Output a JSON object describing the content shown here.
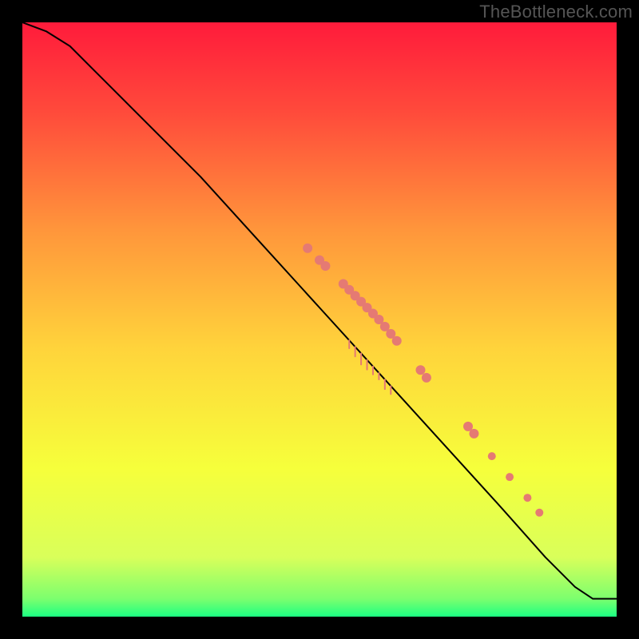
{
  "watermark": "TheBottleneck.com",
  "chart_data": {
    "type": "line",
    "title": "",
    "xlabel": "",
    "ylabel": "",
    "xlim": [
      0,
      100
    ],
    "ylim": [
      0,
      100
    ],
    "grid": false,
    "legend": false,
    "gradient_bg": {
      "stops": [
        {
          "offset": 0.0,
          "color": "#ff1b3b"
        },
        {
          "offset": 0.15,
          "color": "#ff4a3b"
        },
        {
          "offset": 0.35,
          "color": "#ff963b"
        },
        {
          "offset": 0.55,
          "color": "#ffd43b"
        },
        {
          "offset": 0.75,
          "color": "#f6ff3b"
        },
        {
          "offset": 0.9,
          "color": "#d9ff5a"
        },
        {
          "offset": 0.97,
          "color": "#7cff6e"
        },
        {
          "offset": 1.0,
          "color": "#1cff82"
        }
      ]
    },
    "series": [
      {
        "name": "curve",
        "x": [
          0,
          4,
          8,
          12,
          18,
          24,
          30,
          40,
          50,
          60,
          70,
          80,
          88,
          93,
          96,
          100
        ],
        "y": [
          100,
          98.5,
          96,
          92,
          86,
          80,
          74,
          63,
          52,
          41,
          30,
          19,
          10,
          5,
          3,
          3
        ],
        "color": "#000000",
        "stroke_width": 2
      }
    ],
    "markers": [
      {
        "name": "marker-group-a",
        "x": 48,
        "y": 62,
        "r": 6,
        "color": "#e57a73"
      },
      {
        "name": "marker-group-a",
        "x": 50,
        "y": 60,
        "r": 6,
        "color": "#e57a73"
      },
      {
        "name": "marker-group-a",
        "x": 51,
        "y": 59,
        "r": 6,
        "color": "#e57a73"
      },
      {
        "name": "marker-group-b",
        "x": 54,
        "y": 56,
        "r": 6,
        "color": "#e57a73"
      },
      {
        "name": "marker-group-b",
        "x": 55,
        "y": 55,
        "r": 6,
        "color": "#e57a73"
      },
      {
        "name": "marker-group-b",
        "x": 56,
        "y": 54,
        "r": 6,
        "color": "#e57a73"
      },
      {
        "name": "marker-group-b",
        "x": 57,
        "y": 53,
        "r": 6,
        "color": "#e57a73"
      },
      {
        "name": "marker-group-b",
        "x": 58,
        "y": 52,
        "r": 6,
        "color": "#e57a73"
      },
      {
        "name": "marker-group-b",
        "x": 59,
        "y": 51,
        "r": 6,
        "color": "#e57a73"
      },
      {
        "name": "marker-group-b",
        "x": 60,
        "y": 50,
        "r": 6,
        "color": "#e57a73"
      },
      {
        "name": "marker-group-b",
        "x": 61,
        "y": 48.8,
        "r": 6,
        "color": "#e57a73"
      },
      {
        "name": "marker-group-b",
        "x": 62,
        "y": 47.6,
        "r": 6,
        "color": "#e57a73"
      },
      {
        "name": "marker-group-b",
        "x": 63,
        "y": 46.4,
        "r": 6,
        "color": "#e57a73"
      },
      {
        "name": "marker-group-c",
        "x": 67,
        "y": 41.5,
        "r": 6,
        "color": "#e57a73"
      },
      {
        "name": "marker-group-c",
        "x": 68,
        "y": 40.2,
        "r": 6,
        "color": "#e57a73"
      },
      {
        "name": "marker-group-d",
        "x": 75,
        "y": 32,
        "r": 6,
        "color": "#e57a73"
      },
      {
        "name": "marker-group-d",
        "x": 76,
        "y": 30.8,
        "r": 6,
        "color": "#e57a73"
      },
      {
        "name": "marker-group-e",
        "x": 79,
        "y": 27,
        "r": 5,
        "color": "#e57a73"
      },
      {
        "name": "marker-group-f",
        "x": 82,
        "y": 23.5,
        "r": 5,
        "color": "#e57a73"
      },
      {
        "name": "marker-group-g",
        "x": 85,
        "y": 20,
        "r": 5,
        "color": "#e57a73"
      },
      {
        "name": "marker-group-h",
        "x": 87,
        "y": 17.5,
        "r": 5,
        "color": "#e57a73"
      }
    ],
    "tassels": [
      {
        "x": 55,
        "len": 10
      },
      {
        "x": 56,
        "len": 12
      },
      {
        "x": 57,
        "len": 14
      },
      {
        "x": 58,
        "len": 12
      },
      {
        "x": 59,
        "len": 10
      },
      {
        "x": 60,
        "len": 8
      },
      {
        "x": 61,
        "len": 12
      },
      {
        "x": 62,
        "len": 10
      }
    ]
  }
}
